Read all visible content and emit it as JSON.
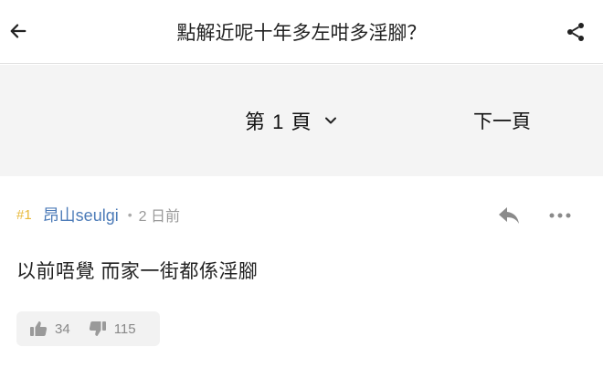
{
  "header": {
    "title": "點解近呢十年多左咁多淫腳？",
    "back_icon": "arrow-left-icon",
    "share_icon": "share-icon"
  },
  "pagination": {
    "current_page_label": "第 1 頁",
    "next_label": "下一頁"
  },
  "post": {
    "number": "#1",
    "username": "昂山seulgi",
    "separator": "•",
    "time": "2 日前",
    "content": "以前唔覺 而家一街都係淫腳",
    "likes": "34",
    "dislikes": "115"
  },
  "colors": {
    "post_number": "#e8b93a",
    "username": "#4c7bb8",
    "pagebar_bg": "#f4f4f4"
  }
}
